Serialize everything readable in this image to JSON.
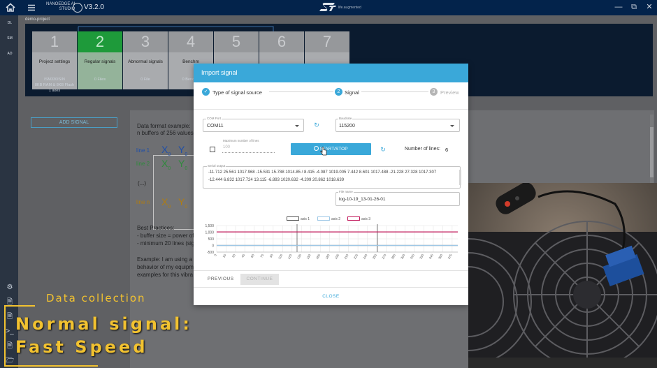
{
  "titlebar": {
    "brand_line1": "NANOEDGE AI",
    "brand_line2": "STUDIO",
    "version": "V3.2.0",
    "st_tagline": "life.augmented"
  },
  "rail": {
    "tiles": [
      {
        "label": "DL",
        "color": "#6b7c8f"
      },
      {
        "label": "SM",
        "color": "#6b7c8f"
      },
      {
        "label": "AD",
        "color": "#2e9e4a"
      }
    ]
  },
  "project_label": "demo-project",
  "steps": [
    {
      "num": "1",
      "title": "Project settings",
      "sub1": "ISM330IS/N",
      "sub2": "8KB RAM & 8KB Flash",
      "sub3": "1 axes"
    },
    {
      "num": "2",
      "title": "Regular signals",
      "sub1": "0 Files"
    },
    {
      "num": "3",
      "title": "Abnormal signals",
      "sub1": "0 File"
    },
    {
      "num": "4",
      "title": "Benchm",
      "sub1": "0 Benchm"
    },
    {
      "num": "5",
      "title": ""
    },
    {
      "num": "6",
      "title": "V"
    },
    {
      "num": "7",
      "title": ""
    }
  ],
  "add_signal_label": "ADD SIGNAL",
  "doc": {
    "format_title": "Data format example:",
    "format_sub": "n buffers of 256 values",
    "line1": "line 1",
    "line2": "line 2",
    "ellipsis": "(...)",
    "linen": "line n",
    "x": "X",
    "y": "Y",
    "sub0": "0",
    "best_practices": "Best Practices:",
    "bp1": "- buffer size = power of",
    "bp2": "- minimum 20 lines (sign",
    "example1": "Example: I am using a",
    "example2": "behavior of my equipm",
    "example3": "examples for this vibra"
  },
  "modal": {
    "title": "Import signal",
    "steps": [
      {
        "marker": "✓",
        "label": "Type of signal source",
        "state": "done"
      },
      {
        "marker": "2",
        "label": "Signal",
        "state": "active"
      },
      {
        "marker": "3",
        "label": "Preview",
        "state": "pending"
      }
    ],
    "com_port": {
      "legend": "COM Port",
      "value": "COM11"
    },
    "baudrate": {
      "legend": "Baudrate",
      "value": "115200"
    },
    "max_lines": {
      "legend": "Maximum number of lines",
      "placeholder": "100"
    },
    "start_stop_label": "START/STOP",
    "number_of_lines_label": "Number of lines:",
    "number_of_lines_value": "6",
    "serial_output": {
      "legend": "Serial output",
      "line1": "-11.712 25.561 1017.968 -15.531 15.788 1014.85 / 8.415 -4.087 1019.005 7.442 8.601 1017.488 -21.228 27.328 1017.307",
      "line2": "-12.444 6.832 1017.724 13.115 -6.893 1020.632 -4.209 20.862 1018.639"
    },
    "file_name": {
      "legend": "File name",
      "value": "log-10-19_13-01-26-01"
    },
    "prev_label": "PREVIOUS",
    "continue_label": "CONTINUE",
    "close_label": "CLOSE"
  },
  "chart_data": {
    "type": "line",
    "series": [
      {
        "name": "axis 1",
        "color": "#555555",
        "value": 0
      },
      {
        "name": "axis 2",
        "color": "#9ec8e6",
        "value": 0
      },
      {
        "name": "axis 3",
        "color": "#c2185b",
        "value": 1020
      }
    ],
    "y_ticks": [
      "1,500",
      "1,000",
      "500",
      "0",
      "-500"
    ],
    "y_tick_values": [
      1500,
      1000,
      500,
      0,
      -500
    ],
    "ylim": [
      -500,
      1500
    ],
    "x_ticks": [
      "0",
      "15",
      "30",
      "45",
      "60",
      "75",
      "90",
      "105",
      "120",
      "135",
      "150",
      "165",
      "180",
      "195",
      "210",
      "225",
      "240",
      "255",
      "270",
      "285",
      "300",
      "315",
      "330",
      "345",
      "360",
      "375"
    ],
    "x_tick_values": [
      0,
      15,
      30,
      45,
      60,
      75,
      90,
      105,
      120,
      135,
      150,
      165,
      180,
      195,
      210,
      225,
      240,
      255,
      270,
      285,
      300,
      315,
      330,
      345,
      360,
      375
    ],
    "xlim": [
      0,
      384
    ],
    "buffer_separators": [
      128,
      256
    ],
    "grid": true,
    "legend_position": "top-center"
  },
  "caption": {
    "small": "Data collection",
    "big_line1": "Normal signal:",
    "big_line2": "Fast Speed",
    "color": "#f2c230"
  },
  "colors": {
    "accent": "#3aa8d9",
    "titlebar": "#03234b",
    "active_step": "#1e9a3a"
  }
}
